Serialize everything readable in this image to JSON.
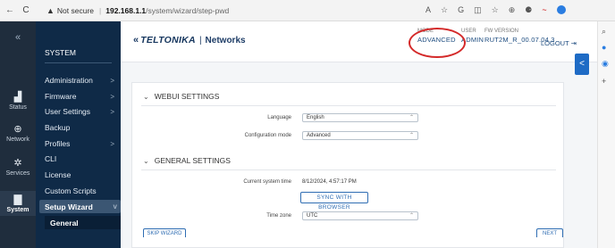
{
  "browser": {
    "back": "←",
    "reload": "C",
    "warning_icon": "▲",
    "not_secure": "Not secure",
    "separator": "|",
    "host": "192.168.1.1",
    "path": "/system/wizard/step-pwd",
    "toolbar_icons": [
      "A",
      "☆",
      "G",
      "◫",
      "☆",
      "⊕",
      "⚈",
      "~"
    ]
  },
  "iconbar": {
    "collapse": "«",
    "items": [
      {
        "label": "Status",
        "icon": "chart-bar-icon",
        "glyph": "▟"
      },
      {
        "label": "Network",
        "icon": "globe-icon",
        "glyph": "⊕"
      },
      {
        "label": "Services",
        "icon": "gear-icon",
        "glyph": "✲"
      },
      {
        "label": "System",
        "icon": "file-icon",
        "glyph": "▇"
      }
    ]
  },
  "sidebar": {
    "heading": "SYSTEM",
    "items": [
      {
        "label": "Administration",
        "chevron": ">"
      },
      {
        "label": "Firmware",
        "chevron": ">"
      },
      {
        "label": "User Settings",
        "chevron": ">"
      },
      {
        "label": "Backup",
        "chevron": ""
      },
      {
        "label": "Profiles",
        "chevron": ">"
      },
      {
        "label": "CLI",
        "chevron": ""
      },
      {
        "label": "License",
        "chevron": ""
      },
      {
        "label": "Custom Scripts",
        "chevron": ""
      },
      {
        "label": "Setup Wizard",
        "chevron": "v"
      }
    ],
    "sub_item": "General"
  },
  "header": {
    "logo_chevrons": "«",
    "logo_brand": "TELTONIKA",
    "logo_pipe": "|",
    "logo_product": "Networks",
    "mode_label": "MODE",
    "mode_value": "ADVANCED",
    "user_label": "USER",
    "user_value": "ADMIN",
    "fw_label": "FW VERSION",
    "fw_value": "RUT2M_R_00.07.04.3",
    "logout": "LOGOUT",
    "logout_icon": "⇥",
    "panel_toggle": "<"
  },
  "webui": {
    "title": "WEBUI SETTINGS",
    "caret": "⌄",
    "language_label": "Language",
    "language_value": "English",
    "config_label": "Configuration mode",
    "config_value": "Advanced"
  },
  "general": {
    "title": "GENERAL SETTINGS",
    "caret": "⌄",
    "time_label": "Current system time",
    "time_value": "8/12/2024, 4:57:17 PM",
    "sync_button": "SYNC WITH BROWSER",
    "tz_label": "Time zone",
    "tz_value": "UTC"
  },
  "footer": {
    "skip": "SKIP WIZARD",
    "next": "NEXT"
  },
  "select_chevron": "⌃",
  "colors": {
    "sidebar": "#0f2a47",
    "accent": "#1e6bc5",
    "highlight_circle": "#d42a2a"
  }
}
